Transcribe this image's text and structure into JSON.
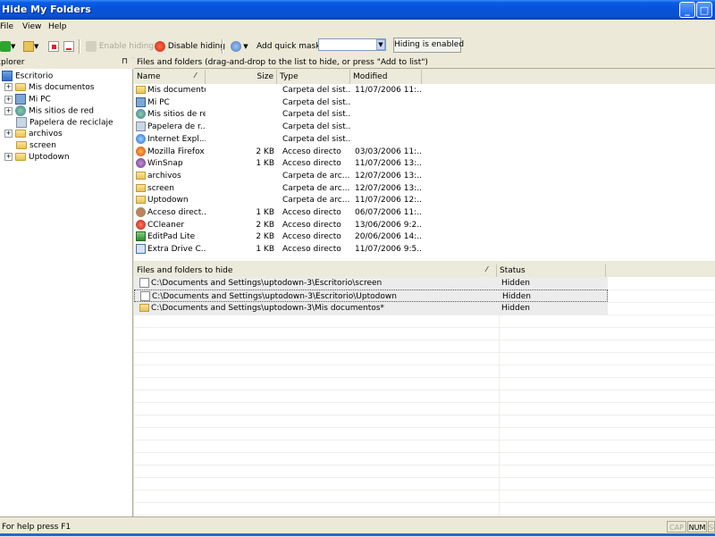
{
  "window": {
    "title": "Hide My Folders"
  },
  "menu": {
    "items": [
      "File",
      "View",
      "Help"
    ]
  },
  "toolbar": {
    "enable_hiding": "Enable hiding",
    "disable_hiding": "Disable hiding",
    "add_quick_mask": "Add quick mask:",
    "quick_mask_value": "",
    "hiding_status": "Hiding is enabled"
  },
  "explorer": {
    "title": "Explorer",
    "root": "Escritorio",
    "items": [
      {
        "label": "Mis documentos",
        "expander": "+"
      },
      {
        "label": "Mi PC",
        "expander": "+"
      },
      {
        "label": "Mis sitios de red",
        "expander": "+"
      },
      {
        "label": "Papelera de reciclaje",
        "expander": ""
      },
      {
        "label": "archivos",
        "expander": "+"
      },
      {
        "label": "screen",
        "expander": ""
      },
      {
        "label": "Uptodown",
        "expander": "+"
      }
    ]
  },
  "files": {
    "caption": "Files and folders (drag-and-drop to the list to hide, or press \"Add to list\")",
    "columns": {
      "name": "Name",
      "size": "Size",
      "type": "Type",
      "modified": "Modified"
    },
    "rows": [
      {
        "name": "Mis documentos",
        "size": "",
        "type": "Carpeta del sist...",
        "modified": "11/07/2006 11:...",
        "icon": "folder"
      },
      {
        "name": "Mi PC",
        "size": "",
        "type": "Carpeta del sist...",
        "modified": "",
        "icon": "computer"
      },
      {
        "name": "Mis sitios de red",
        "size": "",
        "type": "Carpeta del sist...",
        "modified": "",
        "icon": "network"
      },
      {
        "name": "Papelera de r...",
        "size": "",
        "type": "Carpeta del sist...",
        "modified": "",
        "icon": "recycle"
      },
      {
        "name": "Internet Expl...",
        "size": "",
        "type": "Carpeta del sist...",
        "modified": "",
        "icon": "ie"
      },
      {
        "name": "Mozilla Firefox",
        "size": "2 KB",
        "type": "Acceso directo",
        "modified": "03/03/2006 11:...",
        "icon": "firefox"
      },
      {
        "name": "WinSnap",
        "size": "1 KB",
        "type": "Acceso directo",
        "modified": "11/07/2006 13:...",
        "icon": "winsnap"
      },
      {
        "name": "archivos",
        "size": "",
        "type": "Carpeta de arc...",
        "modified": "12/07/2006 13:...",
        "icon": "folder"
      },
      {
        "name": "screen",
        "size": "",
        "type": "Carpeta de arc...",
        "modified": "12/07/2006 13:...",
        "icon": "folder"
      },
      {
        "name": "Uptodown",
        "size": "",
        "type": "Carpeta de arc...",
        "modified": "11/07/2006 12:...",
        "icon": "folder"
      },
      {
        "name": "Acceso direct...",
        "size": "1 KB",
        "type": "Acceso directo",
        "modified": "06/07/2006 11:...",
        "icon": "shortcut"
      },
      {
        "name": "CCleaner",
        "size": "2 KB",
        "type": "Acceso directo",
        "modified": "13/06/2006 9:2...",
        "icon": "ccleaner"
      },
      {
        "name": "EditPad Lite",
        "size": "2 KB",
        "type": "Acceso directo",
        "modified": "20/06/2006 14:...",
        "icon": "editpad"
      },
      {
        "name": "Extra Drive C...",
        "size": "1 KB",
        "type": "Acceso directo",
        "modified": "11/07/2006 9:5...",
        "icon": "extradrive"
      }
    ]
  },
  "hide_list": {
    "columns": {
      "path": "Files and folders to hide",
      "status": "Status"
    },
    "rows": [
      {
        "path": "C:\\Documents and Settings\\uptodown-3\\Escritorio\\screen",
        "status": "Hidden",
        "icon": "file"
      },
      {
        "path": "C:\\Documents and Settings\\uptodown-3\\Escritorio\\Uptodown",
        "status": "Hidden",
        "icon": "file"
      },
      {
        "path": "C:\\Documents and Settings\\uptodown-3\\Mis documentos*",
        "status": "Hidden",
        "icon": "folder"
      }
    ]
  },
  "statusbar": {
    "text": "For help press F1",
    "caps": "CAP",
    "num": "NUM",
    "scroll": "SCRL"
  },
  "colors": {
    "titlebar": "#0a5ee6",
    "selected_row": "#ececec",
    "folder": "#f2d57a"
  }
}
